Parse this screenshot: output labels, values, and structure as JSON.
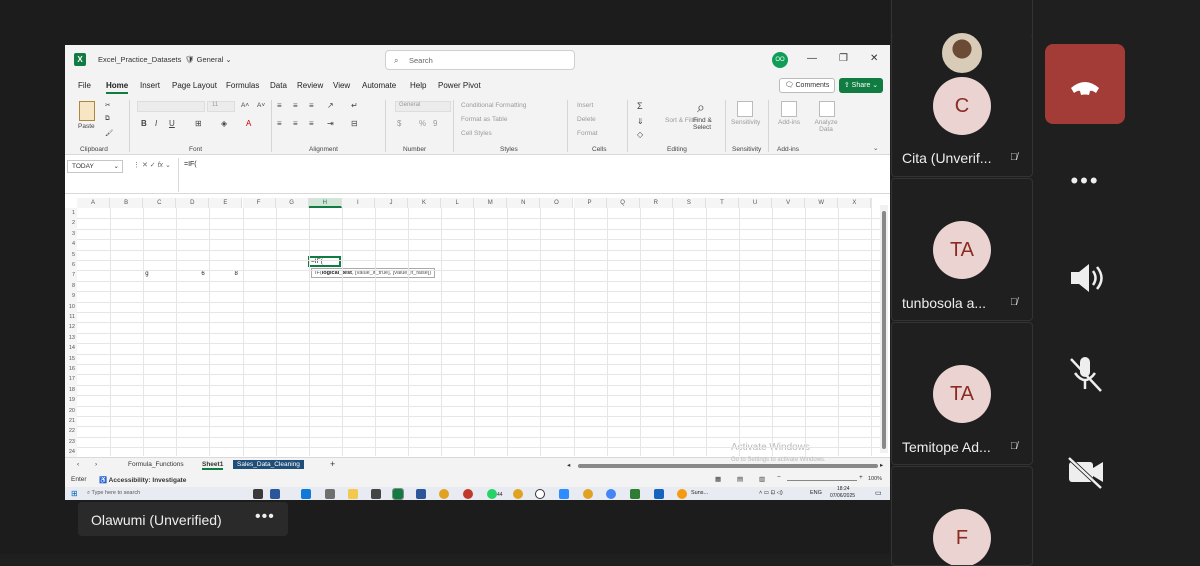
{
  "excel": {
    "workbook_name": "Excel_Practice_Datasets",
    "sensitivity": "General",
    "search_placeholder": "Search",
    "coauthor_initials": "OO",
    "menu": [
      "File",
      "Home",
      "Insert",
      "Page Layout",
      "Formulas",
      "Data",
      "Review",
      "View",
      "Automate",
      "Help",
      "Power Pivot"
    ],
    "comments_label": "Comments",
    "share_label": "Share",
    "ribbon_groups": [
      "Clipboard",
      "Font",
      "Alignment",
      "Number",
      "Styles",
      "Cells",
      "Editing",
      "Sensitivity",
      "Add-ins"
    ],
    "ribbon": {
      "paste": "Paste",
      "number_format": "General",
      "conditional_formatting": "Conditional Formatting",
      "format_as_table": "Format as Table",
      "cell_styles": "Cell Styles",
      "insert": "Insert",
      "delete": "Delete",
      "format": "Format",
      "sort_filter": "Sort & Filter",
      "find_select": "Find & Select",
      "sensitivity": "Sensitivity",
      "add_ins": "Add-ins",
      "analyze_data": "Analyze Data",
      "font_size": "11"
    },
    "name_box": "TODAY",
    "formula": "=IF(",
    "columns": [
      "A",
      "B",
      "C",
      "D",
      "E",
      "F",
      "G",
      "H",
      "I",
      "J",
      "K",
      "L",
      "M",
      "N",
      "O",
      "P",
      "Q",
      "R",
      "S",
      "T",
      "U",
      "V",
      "W",
      "X"
    ],
    "selected_column": "H",
    "rows": [
      "1",
      "2",
      "3",
      "4",
      "5",
      "6",
      "7",
      "8",
      "9",
      "10",
      "11",
      "12",
      "13",
      "14",
      "15",
      "16",
      "17",
      "18",
      "19",
      "20",
      "21",
      "22",
      "23",
      "24"
    ],
    "cells": {
      "C7": "g",
      "D7": "6",
      "E7": "8"
    },
    "active_cell_text": "=IF(",
    "tooltip": {
      "fn": "IF(",
      "bold_arg": "logical_test",
      "rest": ", [value_if_true], [value_if_false])"
    },
    "watermark_title": "Activate Windows",
    "watermark_sub": "Go to Settings to activate Windows.",
    "sheets": [
      "Formula_Functions",
      "Sheet1",
      "Sales_Data_Cleaning"
    ],
    "status_mode": "Enter",
    "accessibility": "Accessibility: Investigate",
    "zoom": "100%"
  },
  "taskbar": {
    "search_placeholder": "Type here to search",
    "weather": "Suns...",
    "language": "ENG",
    "time": "18:24",
    "date": "07/06/2025",
    "whatsapp_badge": "44"
  },
  "meeting": {
    "self_name": "Olawumi (Unverified)",
    "participants": [
      {
        "initials": "C",
        "name": "Cita (Unverif..."
      },
      {
        "initials": "TA",
        "name": "tunbosola a..."
      },
      {
        "initials": "TA",
        "name": "Temitope Ad..."
      },
      {
        "initials": "F",
        "name": ""
      }
    ]
  }
}
